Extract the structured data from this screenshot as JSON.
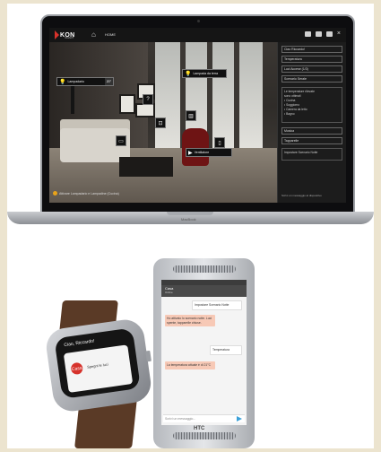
{
  "laptop": {
    "app": {
      "logo_text": "KON",
      "logo_sub": "SMART",
      "nav_title": "HOME",
      "room_controls": [
        {
          "label": "Lampadario",
          "value": "20°"
        },
        {
          "label": "Lampada da terra",
          "value": ""
        },
        {
          "label": "Ventilatore",
          "value": ""
        }
      ],
      "status_text": "Attivare Lampadario e Lampadine (Cucina)",
      "side_panel": {
        "items": [
          "Ciao Riccardo!",
          "Temperatura",
          "Luci Accese (1/3)",
          "Scenario Serale",
          "Musica",
          "Tapparelle"
        ],
        "box_text": [
          "Le temperature rilevate",
          "sono ottimali",
          "• Cucina",
          "• Soggiorno",
          "• Camera da letto",
          "• Bagno"
        ],
        "message_text": "Impostare Scenario Notte",
        "footer_text": "Scrivi un messaggio al dispositivo"
      }
    },
    "brand": "MacBook"
  },
  "phone": {
    "brand": "HTC",
    "header_title": "Casa",
    "header_sub": "Online",
    "messages": [
      {
        "dir": "in",
        "text": "Impostare Scenario Notte"
      },
      {
        "dir": "out",
        "text": "Ho attivato lo scenario notte. Luci spente, tapparelle chiuse."
      },
      {
        "dir": "in",
        "text": "Temperatura"
      },
      {
        "dir": "out",
        "text": "La temperatura attuale è di 21°C"
      }
    ],
    "input_placeholder": "Scrivi un messaggio..."
  },
  "watch": {
    "title": "Ciao, Riccardo!",
    "button_label": "Casa",
    "card_label": "Spegni le luci"
  }
}
